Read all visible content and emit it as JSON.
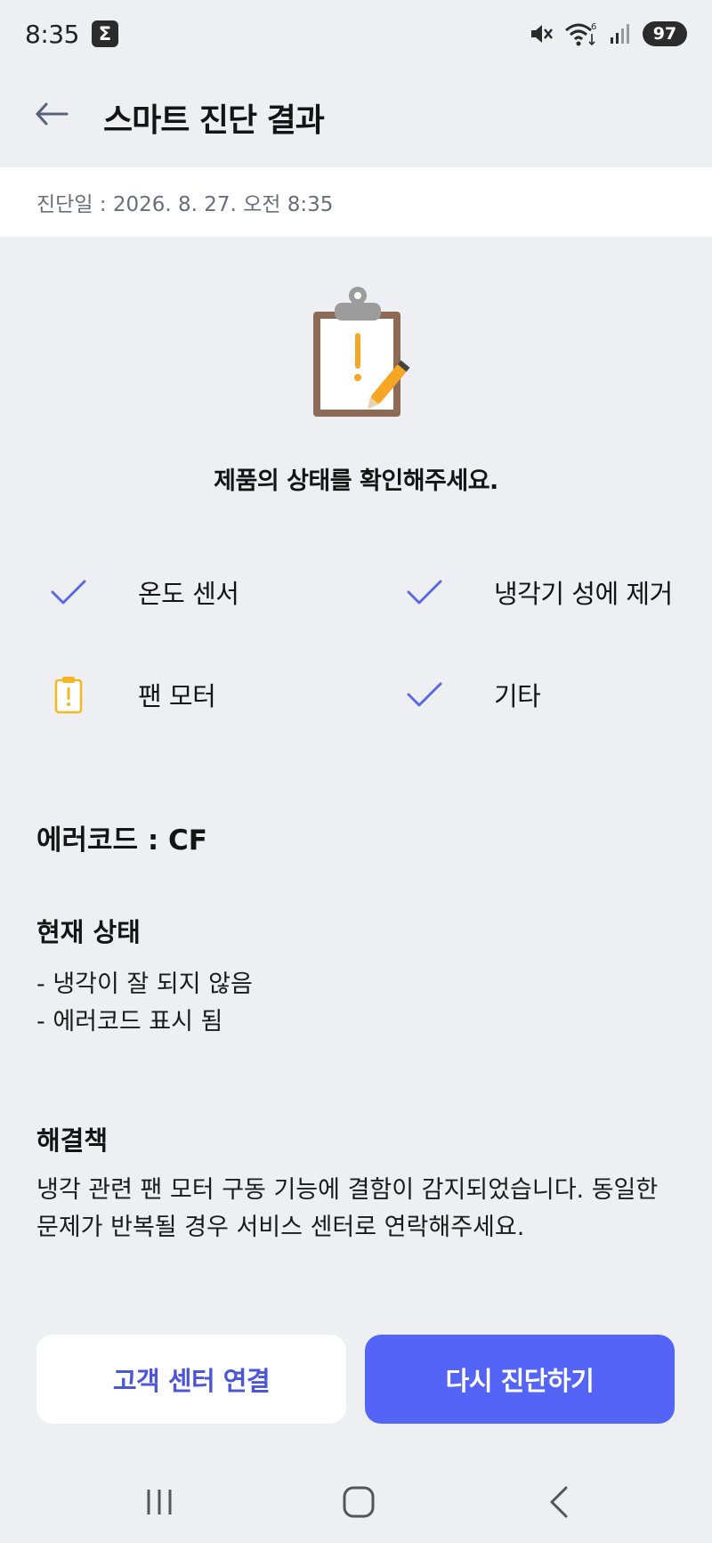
{
  "status_bar": {
    "time": "8:35",
    "badge": "Σ",
    "wifi_badge": "6",
    "battery": "97"
  },
  "header": {
    "title": "스마트 진단 결과"
  },
  "diagnosis": {
    "date_label": "진단일 : 2026. 8. 27. 오전 8:35",
    "prompt": "제품의 상태를 확인해주세요."
  },
  "check_items": [
    {
      "label": "온도 센서",
      "status": "ok"
    },
    {
      "label": "냉각기 성에 제거",
      "status": "ok"
    },
    {
      "label": "팬 모터",
      "status": "warning"
    },
    {
      "label": "기타",
      "status": "ok"
    }
  ],
  "error": {
    "label": "에러코드 : CF"
  },
  "current_status": {
    "title": "현재 상태",
    "lines": [
      "- 냉각이 잘 되지 않음",
      "- 에러코드 표시 됨"
    ]
  },
  "solution": {
    "title": "해결책",
    "text": "냉각 관련 팬 모터 구동 기능에 결함이 감지되었습니다. 동일한 문제가 반복될 경우 서비스 센터로 연락해주세요."
  },
  "buttons": {
    "customer_center": "고객 센터 연결",
    "rediagnose": "다시 진단하기"
  },
  "colors": {
    "accent": "#5364f7",
    "check": "#5a6ae6",
    "warning": "#f5b720",
    "background": "#eeeff3"
  }
}
